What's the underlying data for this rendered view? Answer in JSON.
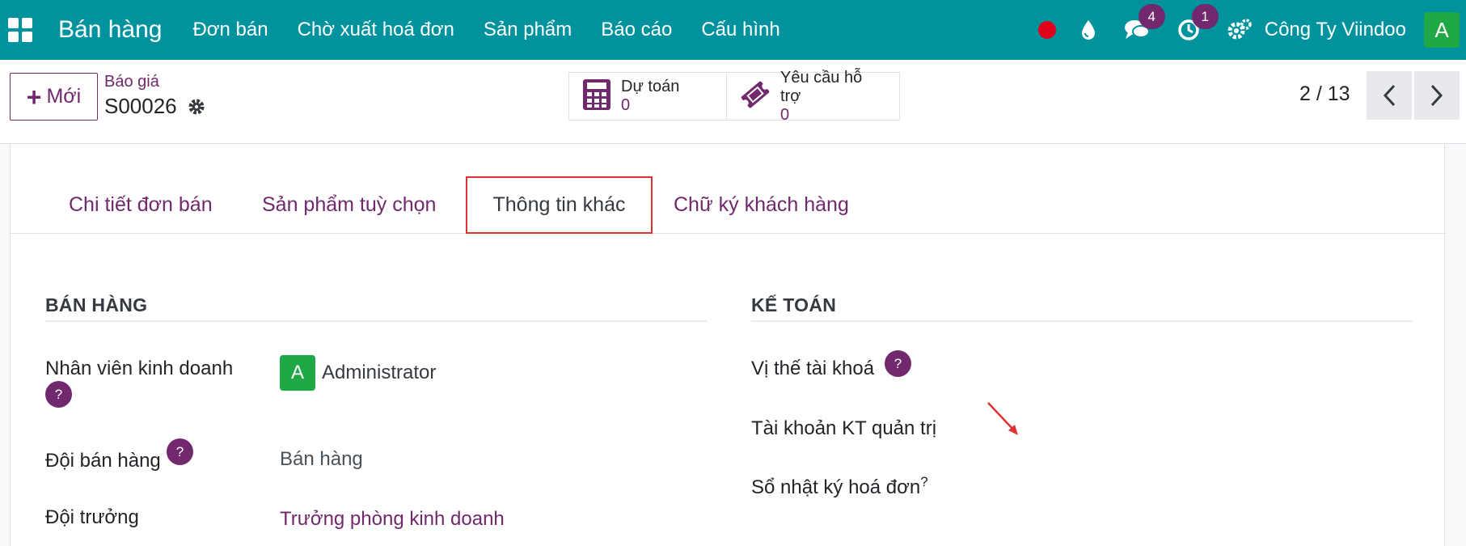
{
  "navbar": {
    "app_title": "Bán hàng",
    "menu": [
      "Đơn bán",
      "Chờ xuất hoá đơn",
      "Sản phẩm",
      "Báo cáo",
      "Cấu hình"
    ],
    "messages_count": "4",
    "activities_count": "1",
    "company": "Công Ty Viindoo",
    "user_avatar": "A",
    "colors": {
      "bar": "#01939d",
      "badge": "#71286c",
      "record": "#e0001b"
    }
  },
  "control": {
    "new_button": "Mới",
    "breadcrumb_parent": "Báo giá",
    "breadcrumb_current": "S00026",
    "smart_buttons": [
      {
        "label": "Dự toán",
        "value": "0",
        "icon": "calculator-icon"
      },
      {
        "label": "Yêu cầu hỗ trợ",
        "value": "0",
        "icon": "ticket-icon"
      }
    ],
    "pager": "2 / 13"
  },
  "tabs": [
    "Chi tiết đơn bán",
    "Sản phẩm tuỳ chọn",
    "Thông tin khác",
    "Chữ ký khách hàng"
  ],
  "active_tab": "Thông tin khác",
  "sales_section": {
    "title": "BÁN HÀNG",
    "salesperson_label": "Nhân viên kinh doanh",
    "salesperson_avatar": "A",
    "salesperson_value": "Administrator",
    "team_label": "Đội bán hàng",
    "team_value": "Bán hàng",
    "leader_label": "Đội trưởng",
    "leader_value": "Trưởng phòng kinh doanh"
  },
  "accounting_section": {
    "title": "KẾ TOÁN",
    "fiscal_position_label": "Vị thế tài khoá",
    "analytic_account_label": "Tài khoản KT quản trị",
    "invoice_journal_label": "Sổ nhật ký hoá đơn"
  },
  "help_mark": "?"
}
